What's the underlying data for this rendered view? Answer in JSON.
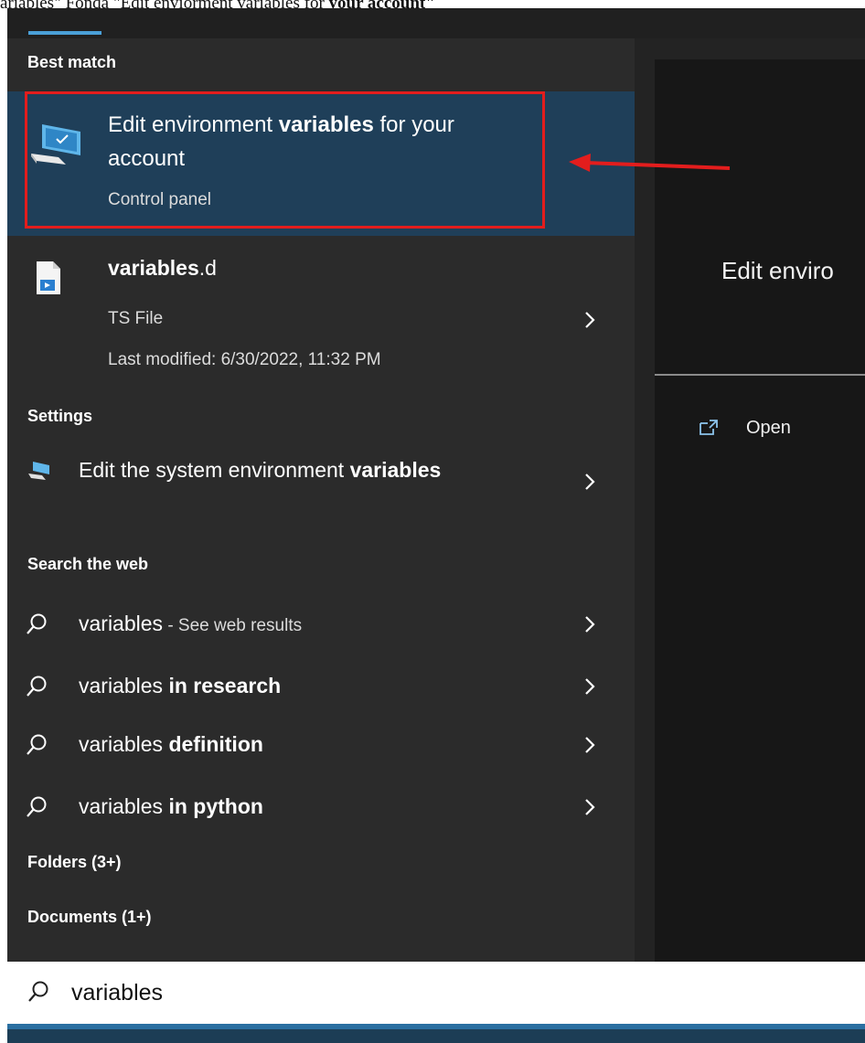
{
  "caption": {
    "prefix": "ariables\" Fonda \"Edit enviorment variables for ",
    "bold": "your account\""
  },
  "results": {
    "best_match_header": "Best match",
    "best_match": {
      "title_pre": "Edit environment ",
      "title_bold": "variables",
      "title_post": " for your account",
      "subtitle": "Control panel",
      "icon": "monitor-settings-icon"
    },
    "file": {
      "title_bold": "variables",
      "title_post": ".d",
      "type": "TS File",
      "modified": "Last modified: 6/30/2022, 11:32 PM",
      "icon": "ts-file-icon"
    },
    "settings_header": "Settings",
    "setting": {
      "title_pre": "Edit the system environment ",
      "title_bold": "variables",
      "icon": "system-settings-icon"
    },
    "web_header": "Search the web",
    "web": [
      {
        "pre": "variables",
        "bold": "",
        "hint": " - See web results"
      },
      {
        "pre": "variables ",
        "bold": "in research",
        "hint": ""
      },
      {
        "pre": "variables ",
        "bold": "definition",
        "hint": ""
      },
      {
        "pre": "variables ",
        "bold": "in python",
        "hint": ""
      }
    ],
    "folders_header": "Folders (3+)",
    "documents_header": "Documents (1+)"
  },
  "preview": {
    "title": "Edit enviro",
    "open_label": "Open",
    "open_icon": "open-window-icon"
  },
  "search": {
    "value": "variables",
    "icon": "search-icon"
  },
  "colors": {
    "highlight": "#1f3f59",
    "annotation": "#e31d1d",
    "accent": "#4aa0d8"
  }
}
